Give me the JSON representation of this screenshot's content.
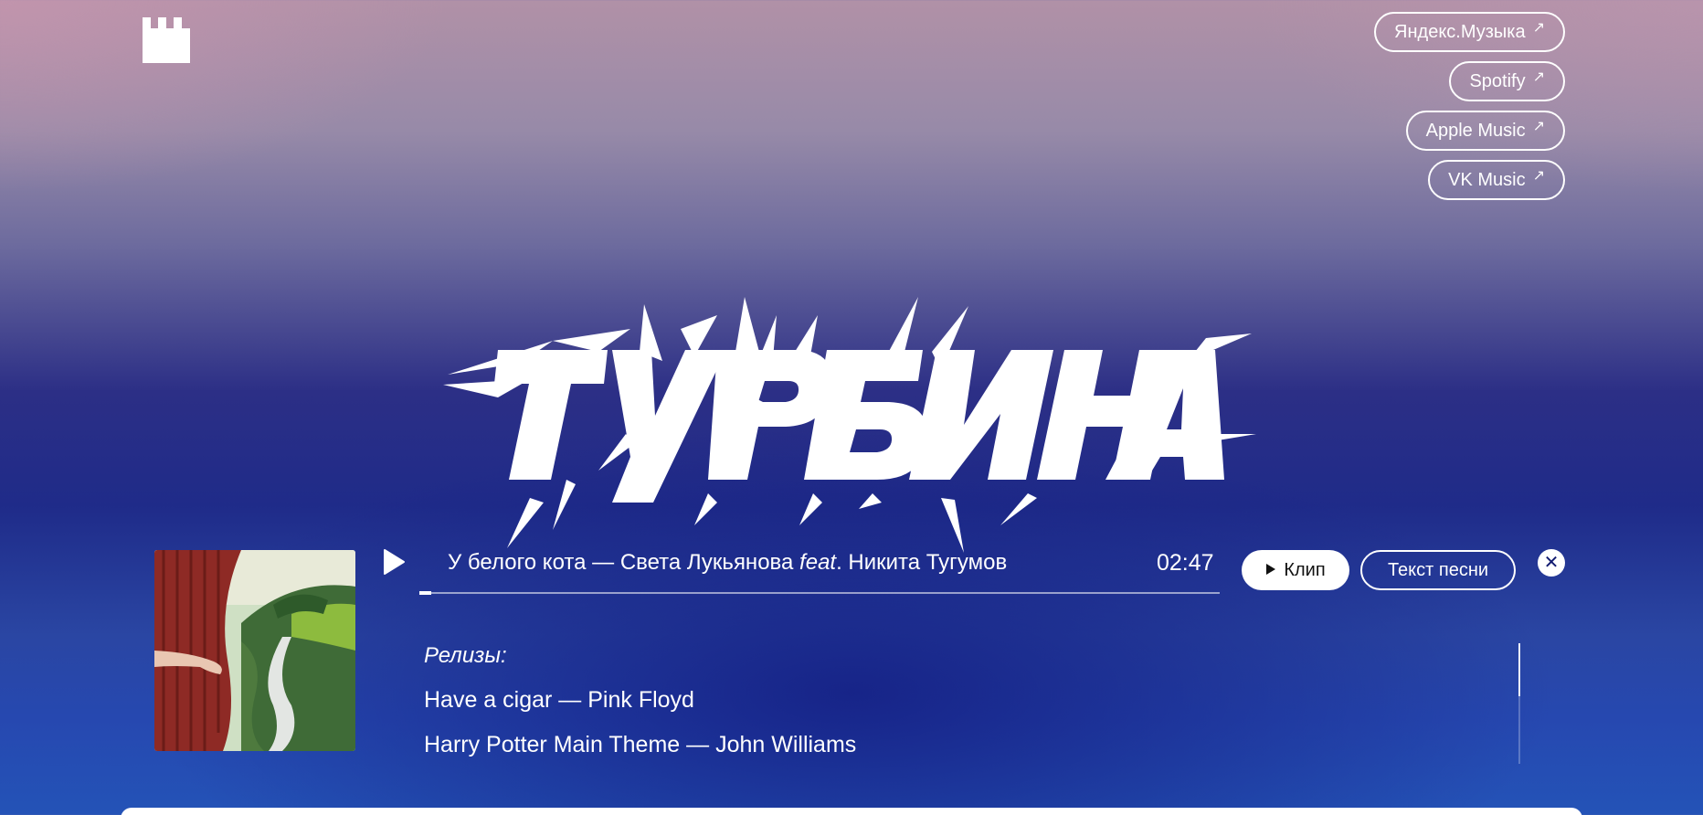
{
  "header": {
    "logo_icon": "castle-tower-icon",
    "streaming_links": [
      {
        "label": "Яндекс.Музыка",
        "arrow": "↗"
      },
      {
        "label": "Spotify",
        "arrow": "↗"
      },
      {
        "label": "Apple Music",
        "arrow": "↗"
      },
      {
        "label": "VK Music",
        "arrow": "↗"
      }
    ]
  },
  "hero": {
    "title": "ТУРБИНА"
  },
  "player": {
    "cover_icon": "album-cover-painting",
    "play_icon": "play-icon",
    "track": {
      "song": "У белого кота",
      "separator": " — ",
      "artist": "Света Лукьянова",
      "feat_word": "feat",
      "feat_artist": ". Никита Тугумов"
    },
    "duration": "02:47",
    "progress_fraction": 0.015,
    "clip_button": {
      "icon": "play-small-icon",
      "label": "Клип"
    },
    "lyrics_button": {
      "label": "Текст песни"
    },
    "close_icon": "close-icon",
    "close_glyph": "✕"
  },
  "releases": {
    "heading": "Релизы:",
    "items": [
      "Have a cigar — Pink Floyd",
      "Harry Potter Main Theme — John Williams"
    ],
    "scroll_fraction": 0.0
  },
  "colors": {
    "accent_white": "#ffffff",
    "deep_blue": "#1f2b89",
    "pink_top": "#b191a7"
  }
}
